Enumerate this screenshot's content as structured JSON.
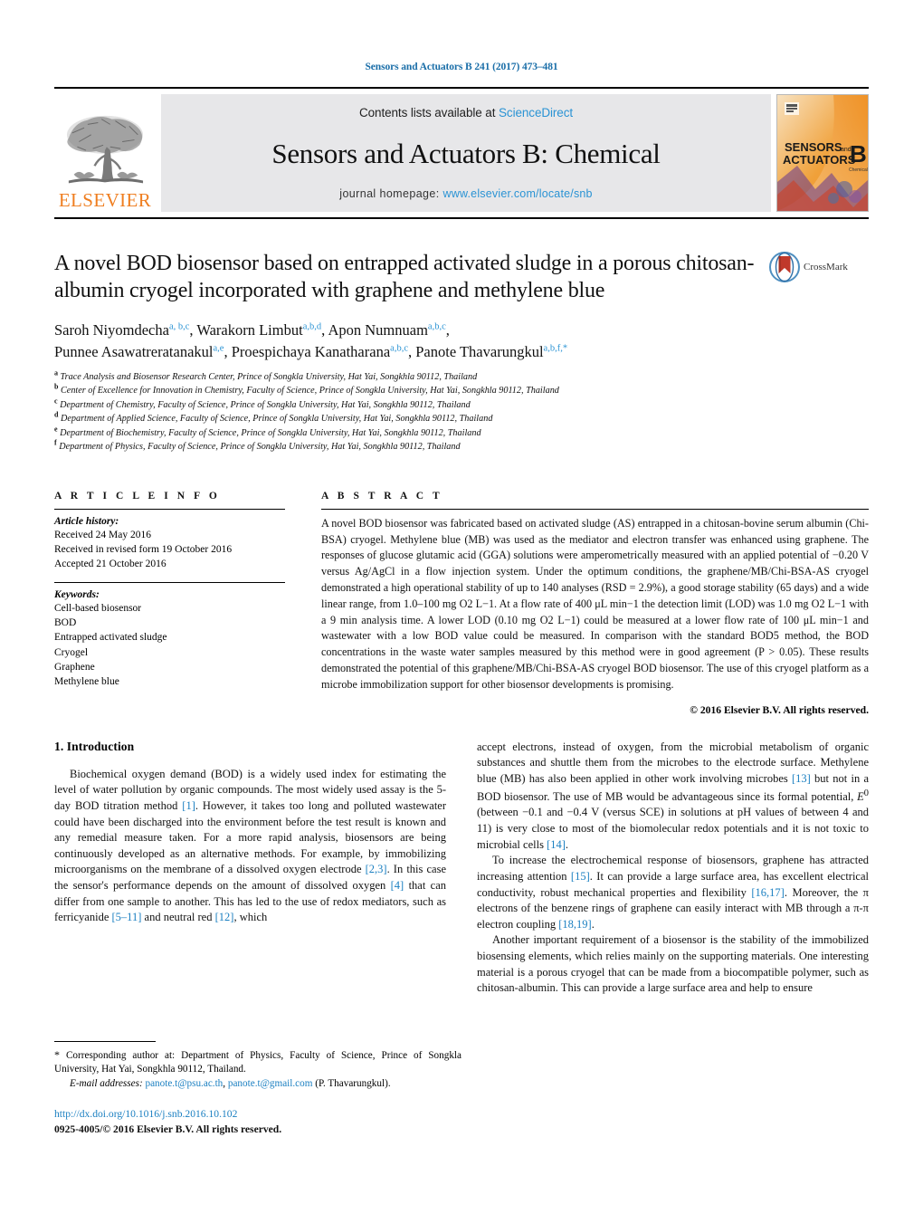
{
  "running_head": "Sensors and Actuators B 241 (2017) 473–481",
  "banner": {
    "contents_prefix": "Contents lists available at ",
    "sciencedirect": "ScienceDirect",
    "journal_title": "Sensors and Actuators B: Chemical",
    "homepage_prefix": "journal homepage: ",
    "homepage_url": "www.elsevier.com/locate/snb",
    "publisher_logo_text": "ELSEVIER",
    "cover_line1": "SENSORS",
    "cover_and": "and",
    "cover_line2": "ACTUATORS",
    "cover_letter": "B",
    "cover_sub": "Chemical"
  },
  "crossmark": {
    "label": "CrossMark"
  },
  "article": {
    "title": "A novel BOD biosensor based on entrapped activated sludge in a porous chitosan-albumin cryogel incorporated with graphene and methylene blue",
    "authors_line1_a": "Saroh Niyomdecha",
    "authors_line1_a_sup": "a, b,c",
    "authors_line1_b": "Warakorn Limbut",
    "authors_line1_b_sup": "a,b,d",
    "authors_line1_c": "Apon Numnuam",
    "authors_line1_c_sup": "a,b,c",
    "authors_line2_a": "Punnee Asawatreratanakul",
    "authors_line2_a_sup": "a,e",
    "authors_line2_b": "Proespichaya Kanatharana",
    "authors_line2_b_sup": "a,b,c",
    "authors_line2_c": "Panote Thavarungkul",
    "authors_line2_c_sup": "a,b,f,",
    "affiliations": [
      {
        "mark": "a",
        "text": "Trace Analysis and Biosensor Research Center, Prince of Songkla University, Hat Yai, Songkhla 90112, Thailand"
      },
      {
        "mark": "b",
        "text": "Center of Excellence for Innovation in Chemistry, Faculty of Science, Prince of Songkla University, Hat Yai, Songkhla 90112, Thailand"
      },
      {
        "mark": "c",
        "text": "Department of Chemistry, Faculty of Science, Prince of Songkla University, Hat Yai, Songkhla 90112, Thailand"
      },
      {
        "mark": "d",
        "text": "Department of Applied Science, Faculty of Science, Prince of Songkla University, Hat Yai, Songkhla 90112, Thailand"
      },
      {
        "mark": "e",
        "text": "Department of Biochemistry, Faculty of Science, Prince of Songkla University, Hat Yai, Songkhla 90112, Thailand"
      },
      {
        "mark": "f",
        "text": "Department of Physics, Faculty of Science, Prince of Songkla University, Hat Yai, Songkhla 90112, Thailand"
      }
    ]
  },
  "article_info": {
    "heading": "A R T I C L E    I N F O",
    "history_title": "Article history:",
    "history": [
      "Received 24 May 2016",
      "Received in revised form 19 October 2016",
      "Accepted 21 October 2016"
    ],
    "keywords_title": "Keywords:",
    "keywords": [
      "Cell-based biosensor",
      "BOD",
      "Entrapped activated sludge",
      "Cryogel",
      "Graphene",
      "Methylene blue"
    ]
  },
  "abstract": {
    "heading": "A B S T R A C T",
    "text": "A novel BOD biosensor was fabricated based on activated sludge (AS) entrapped in a chitosan-bovine serum albumin (Chi-BSA) cryogel. Methylene blue (MB) was used as the mediator and electron transfer was enhanced using graphene. The responses of glucose glutamic acid (GGA) solutions were amperometrically measured with an applied potential of −0.20 V versus Ag/AgCl in a flow injection system. Under the optimum conditions, the graphene/MB/Chi-BSA-AS cryogel demonstrated a high operational stability of up to 140 analyses (RSD = 2.9%), a good storage stability (65 days) and a wide linear range, from 1.0–100 mg O2 L−1. At a flow rate of 400 μL min−1 the detection limit (LOD) was 1.0 mg O2 L−1 with a 9 min analysis time. A lower LOD (0.10 mg O2 L−1) could be measured at a lower flow rate of 100 μL min−1 and wastewater with a low BOD value could be measured. In comparison with the standard BOD5 method, the BOD concentrations in the waste water samples measured by this method were in good agreement (P > 0.05). These results demonstrated the potential of this graphene/MB/Chi-BSA-AS cryogel BOD biosensor. The use of this cryogel platform as a microbe immobilization support for other biosensor developments is promising.",
    "copyright": "© 2016 Elsevier B.V. All rights reserved."
  },
  "introduction": {
    "section_number_title": "1.  Introduction",
    "left_paragraph_1": "Biochemical oxygen demand (BOD) is a widely used index for estimating the level of water pollution by organic compounds. The most widely used assay is the 5-day BOD titration method [1]. However, it takes too long and polluted wastewater could have been discharged into the environment before the test result is known and any remedial measure taken. For a more rapid analysis, biosensors are being continuously developed as an alternative methods. For example, by immobilizing microorganisms on the membrane of a dissolved oxygen electrode [2,3]. In this case the sensor's performance depends on the amount of dissolved oxygen [4] that can differ from one sample to another. This has led to the use of redox mediators, such as ferricyanide [5–11] and neutral red [12], which",
    "right_paragraph_1_cont": "accept electrons, instead of oxygen, from the microbial metabolism of organic substances and shuttle them from the microbes to the electrode surface. Methylene blue (MB) has also been applied in other work involving microbes [13] but not in a BOD biosensor. The use of MB would be advantageous since its formal potential, E0 (between −0.1 and −0.4 V (versus SCE) in solutions at pH values of between 4 and 11) is very close to most of the biomolecular redox potentials and it is not toxic to microbial cells [14].",
    "right_paragraph_2": "To increase the electrochemical response of biosensors, graphene has attracted increasing attention [15]. It can provide a large surface area, has excellent electrical conductivity, robust mechanical properties and flexibility [16,17]. Moreover, the π electrons of the benzene rings of graphene can easily interact with MB through a π-π electron coupling [18,19].",
    "right_paragraph_3": "Another important requirement of a biosensor is the stability of the immobilized biosensing elements, which relies mainly on the supporting materials. One interesting material is a porous cryogel that can be made from a biocompatible polymer, such as chitosan-albumin. This can provide a large surface area and help to ensure"
  },
  "footnote": {
    "corresponding_star": "*",
    "corresponding_text": "Corresponding author at: Department of Physics, Faculty of Science, Prince of Songkla University, Hat Yai, Songkhla 90112, Thailand.",
    "email_label": "E-mail addresses:",
    "email_1": "panote.t@psu.ac.th",
    "email_2": "panote.t@gmail.com",
    "email_attrib": "(P. Thavarungkul).",
    "doi": "http://dx.doi.org/10.1016/j.snb.2016.10.102",
    "issn": "0925-4005/© 2016 Elsevier B.V. All rights reserved."
  },
  "colors": {
    "link": "#1a7fc1",
    "sciencedirect": "#2a93d4",
    "elsevier_orange": "#ef7e20",
    "banner_gray": "#e7e7e9"
  }
}
